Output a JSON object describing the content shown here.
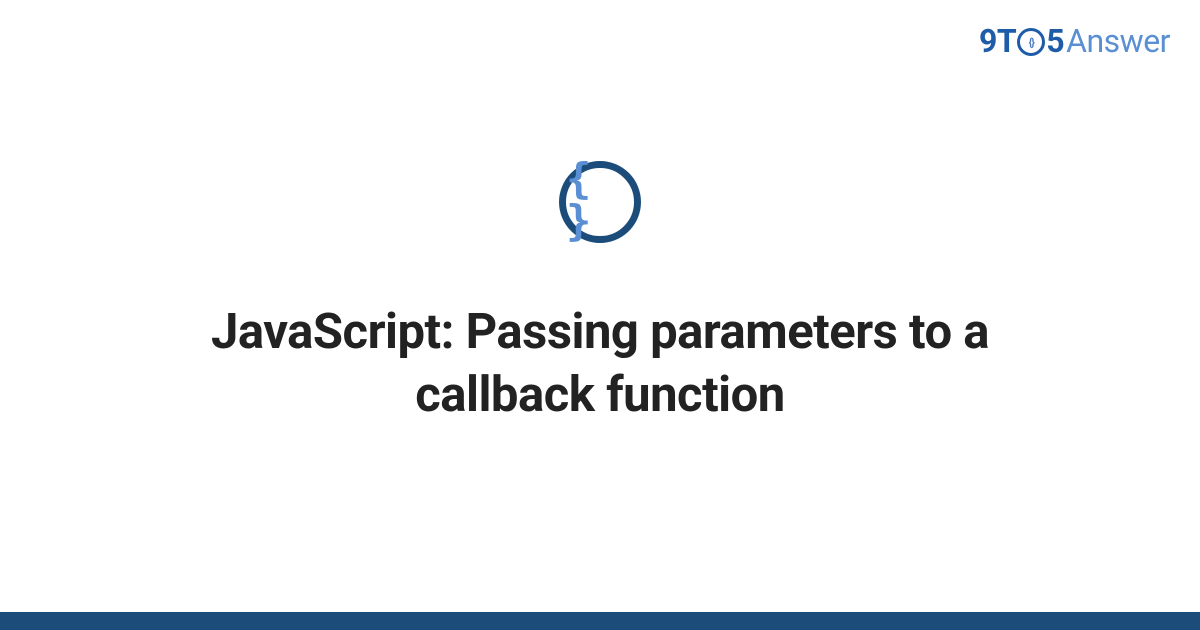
{
  "brand": {
    "part1": "9T",
    "circle_inner": "{}",
    "part2": "5",
    "part3": "Answer"
  },
  "icon": {
    "name": "code-braces-icon",
    "glyph": "{ }",
    "border_color": "#1c4d7a",
    "inner_color": "#5a8fd4"
  },
  "title": "JavaScript: Passing parameters to a callback function",
  "colors": {
    "brand_dark": "#1e5ba8",
    "brand_light": "#5a8fd4",
    "icon_ring": "#1c4d7a",
    "text": "#222222",
    "footer_bar": "#1c4d7a"
  }
}
